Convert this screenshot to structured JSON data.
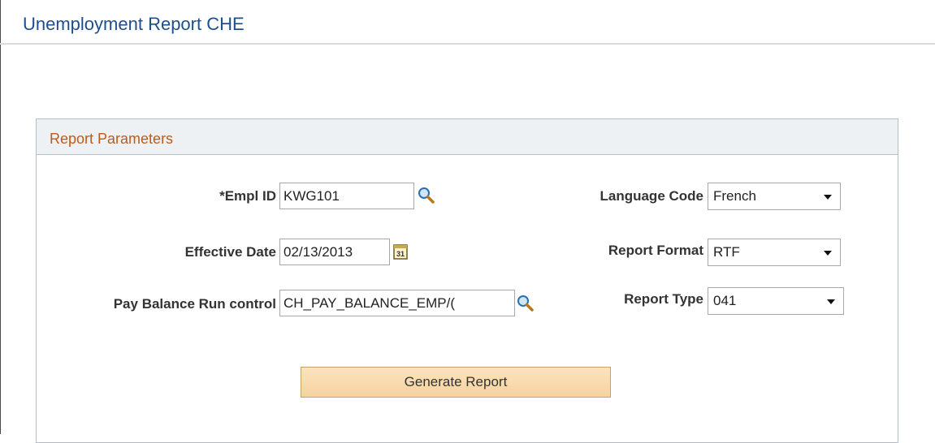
{
  "page": {
    "title": "Unemployment Report CHE"
  },
  "panel": {
    "title": "Report Parameters"
  },
  "fields": {
    "empl_id": {
      "label": "*Empl ID",
      "value": "KWG101"
    },
    "effective_date": {
      "label": "Effective Date",
      "value": "02/13/2013"
    },
    "pay_balance_run_control": {
      "label": "Pay Balance Run control",
      "value": "CH_PAY_BALANCE_EMP/("
    },
    "language_code": {
      "label": "Language Code",
      "value": "French"
    },
    "report_format": {
      "label": "Report Format",
      "value": "RTF"
    },
    "report_type": {
      "label": "Report Type",
      "value": "041"
    }
  },
  "actions": {
    "generate_label": "Generate Report"
  },
  "colors": {
    "title": "#1f4f8a",
    "panel_title": "#c15a17",
    "panel_header_bg": "#eef1f4",
    "button_bg": "#f6d3a0"
  },
  "icons": {
    "lookup": "magnifier-icon",
    "calendar": "calendar-icon"
  }
}
